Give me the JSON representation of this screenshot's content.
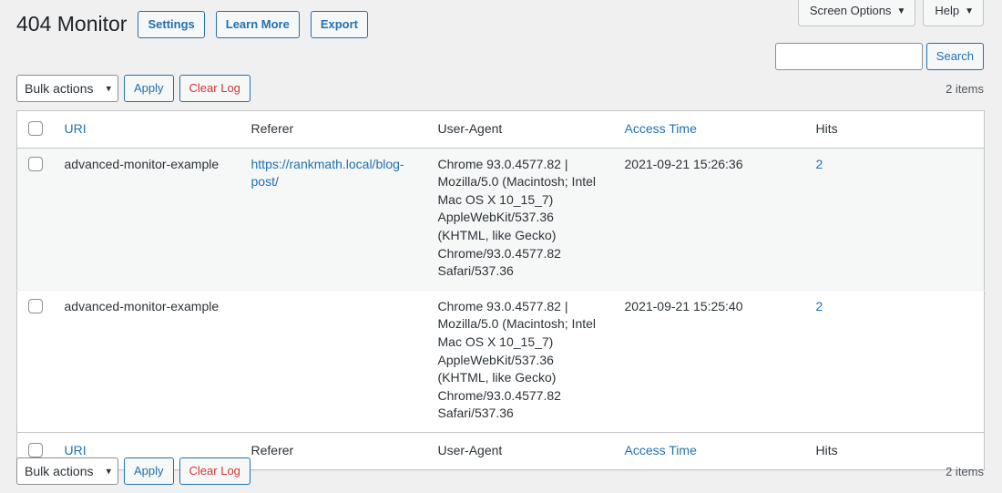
{
  "meta_tabs": [
    {
      "label": "Screen Options",
      "caret": "▼",
      "name": "screen-options-tab"
    },
    {
      "label": "Help",
      "caret": "▼",
      "name": "help-tab"
    }
  ],
  "header": {
    "title": "404 Monitor",
    "actions": [
      {
        "label": "Settings",
        "name": "settings-button"
      },
      {
        "label": "Learn More",
        "name": "learn-more-button"
      },
      {
        "label": "Export",
        "name": "export-button"
      }
    ]
  },
  "search": {
    "value": "",
    "placeholder": "",
    "button_label": "Search"
  },
  "tablenav": {
    "bulk_actions_label": "Bulk actions",
    "bulk_caret": "⌄",
    "apply_label": "Apply",
    "clear_log_label": "Clear Log",
    "displaying_num": "2 items"
  },
  "table": {
    "columns": [
      {
        "label": "URI",
        "sortable": true
      },
      {
        "label": "Referer",
        "sortable": false
      },
      {
        "label": "User-Agent",
        "sortable": false
      },
      {
        "label": "Access Time",
        "sortable": true
      },
      {
        "label": "Hits",
        "sortable": false
      }
    ],
    "rows": [
      {
        "uri": "advanced-monitor-example",
        "referer": "https://rankmath.local/blog-post/",
        "user_agent": "Chrome 93.0.4577.82 | Mozilla/5.0 (Macintosh; Intel Mac OS X 10_15_7) AppleWebKit/537.36 (KHTML, like Gecko) Chrome/93.0.4577.82 Safari/537.36",
        "access_time": "2021-09-21 15:26:36",
        "hits": "2"
      },
      {
        "uri": "advanced-monitor-example",
        "referer": "",
        "user_agent": "Chrome 93.0.4577.82 | Mozilla/5.0 (Macintosh; Intel Mac OS X 10_15_7) AppleWebKit/537.36 (KHTML, like Gecko) Chrome/93.0.4577.82 Safari/537.36",
        "access_time": "2021-09-21 15:25:40",
        "hits": "2"
      }
    ]
  },
  "colors": {
    "link": "#2271b1",
    "danger": "#d63638",
    "page_bg": "#f0f0f1",
    "row_alt": "#f6f7f7",
    "border": "#c3c4c7"
  }
}
